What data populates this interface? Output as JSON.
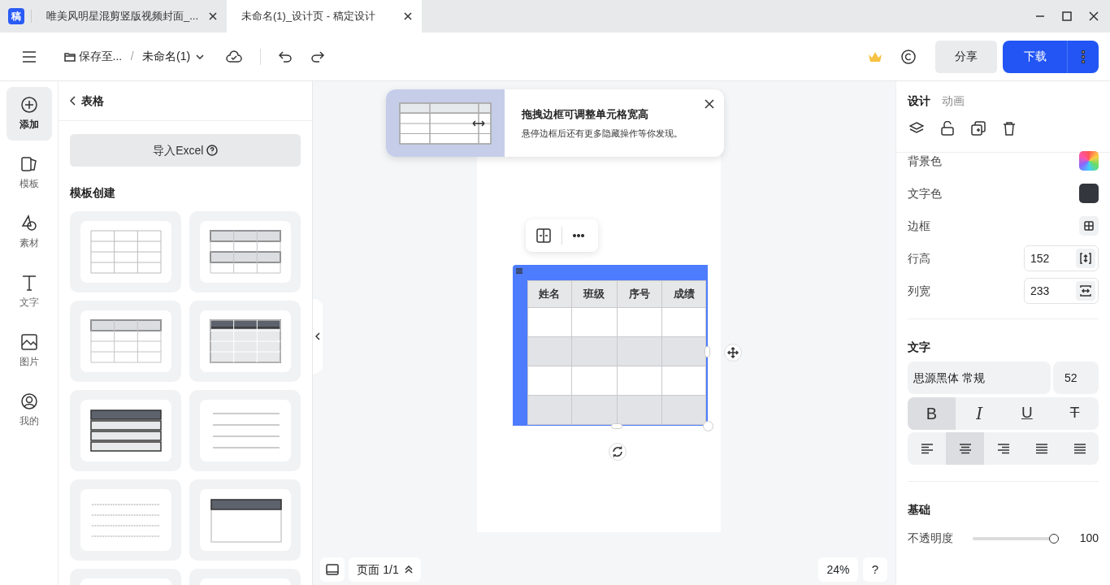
{
  "app_logo": "稿",
  "browser_tabs": [
    {
      "title": "唯美风明星混剪竖版视频封面_...",
      "selected": false
    },
    {
      "title": "未命名(1)_设计页 - 稿定设计",
      "selected": true
    }
  ],
  "toolbar": {
    "save_location": "保存至...",
    "separator": "/",
    "file_name": "未命名(1)",
    "share": "分享",
    "download": "下载"
  },
  "rail": [
    {
      "label": "添加",
      "kind": "add",
      "selected": true
    },
    {
      "label": "模板",
      "kind": "template",
      "selected": false
    },
    {
      "label": "素材",
      "kind": "material",
      "selected": false
    },
    {
      "label": "文字",
      "kind": "text",
      "selected": false
    },
    {
      "label": "图片",
      "kind": "image",
      "selected": false
    },
    {
      "label": "我的",
      "kind": "mine",
      "selected": false
    }
  ],
  "panel": {
    "title": "表格",
    "import_button": "导入Excel",
    "section": "模板创建",
    "templates": [
      {
        "kind": "grid"
      },
      {
        "kind": "banded"
      },
      {
        "kind": "header-light"
      },
      {
        "kind": "header-dark"
      },
      {
        "kind": "header-dark-rows"
      },
      {
        "kind": "lines"
      },
      {
        "kind": "dotted"
      },
      {
        "kind": "header-box"
      },
      {
        "kind": "cut"
      },
      {
        "kind": "cut"
      }
    ]
  },
  "tip": {
    "title": "拖拽边框可调整单元格宽高",
    "text": "悬停边框后还有更多隐藏操作等你发现。"
  },
  "table": {
    "columns": [
      "姓名",
      "班级",
      "序号",
      "成绩"
    ],
    "rows": [
      {
        "shaded": false
      },
      {
        "shaded": true
      },
      {
        "shaded": false
      },
      {
        "shaded": true
      }
    ]
  },
  "bottom": {
    "page": "页面 1/1",
    "zoom": "24%",
    "help": "?"
  },
  "inspector": {
    "tabs": [
      {
        "label": "设计",
        "selected": true
      },
      {
        "label": "动画",
        "selected": false
      }
    ],
    "properties": [
      {
        "label": "背景色",
        "kind": "gradient"
      },
      {
        "label": "文字色",
        "kind": "color",
        "color": "#33363d"
      },
      {
        "label": "边框",
        "kind": "border"
      },
      {
        "label": "行高",
        "kind": "number",
        "value": "152"
      },
      {
        "label": "列宽",
        "kind": "number",
        "value": "233"
      }
    ],
    "text_section": {
      "title": "文字",
      "font": "思源黑体 常规",
      "size": "52",
      "styles": [
        {
          "label": "B",
          "kind": "bold",
          "selected": true
        },
        {
          "label": "I",
          "kind": "italic",
          "selected": false
        },
        {
          "label": "U",
          "kind": "underline",
          "selected": false
        },
        {
          "label": "T",
          "kind": "strike",
          "selected": false
        }
      ],
      "aligns": [
        {
          "kind": "left",
          "selected": false
        },
        {
          "kind": "center",
          "selected": true
        },
        {
          "kind": "right",
          "selected": false
        },
        {
          "kind": "justify",
          "selected": false
        },
        {
          "kind": "distribute",
          "selected": false
        }
      ]
    },
    "basic": {
      "title": "基础",
      "opacity_label": "不透明度",
      "opacity": {
        "level": 1
      },
      "opacity_value": "100"
    }
  }
}
